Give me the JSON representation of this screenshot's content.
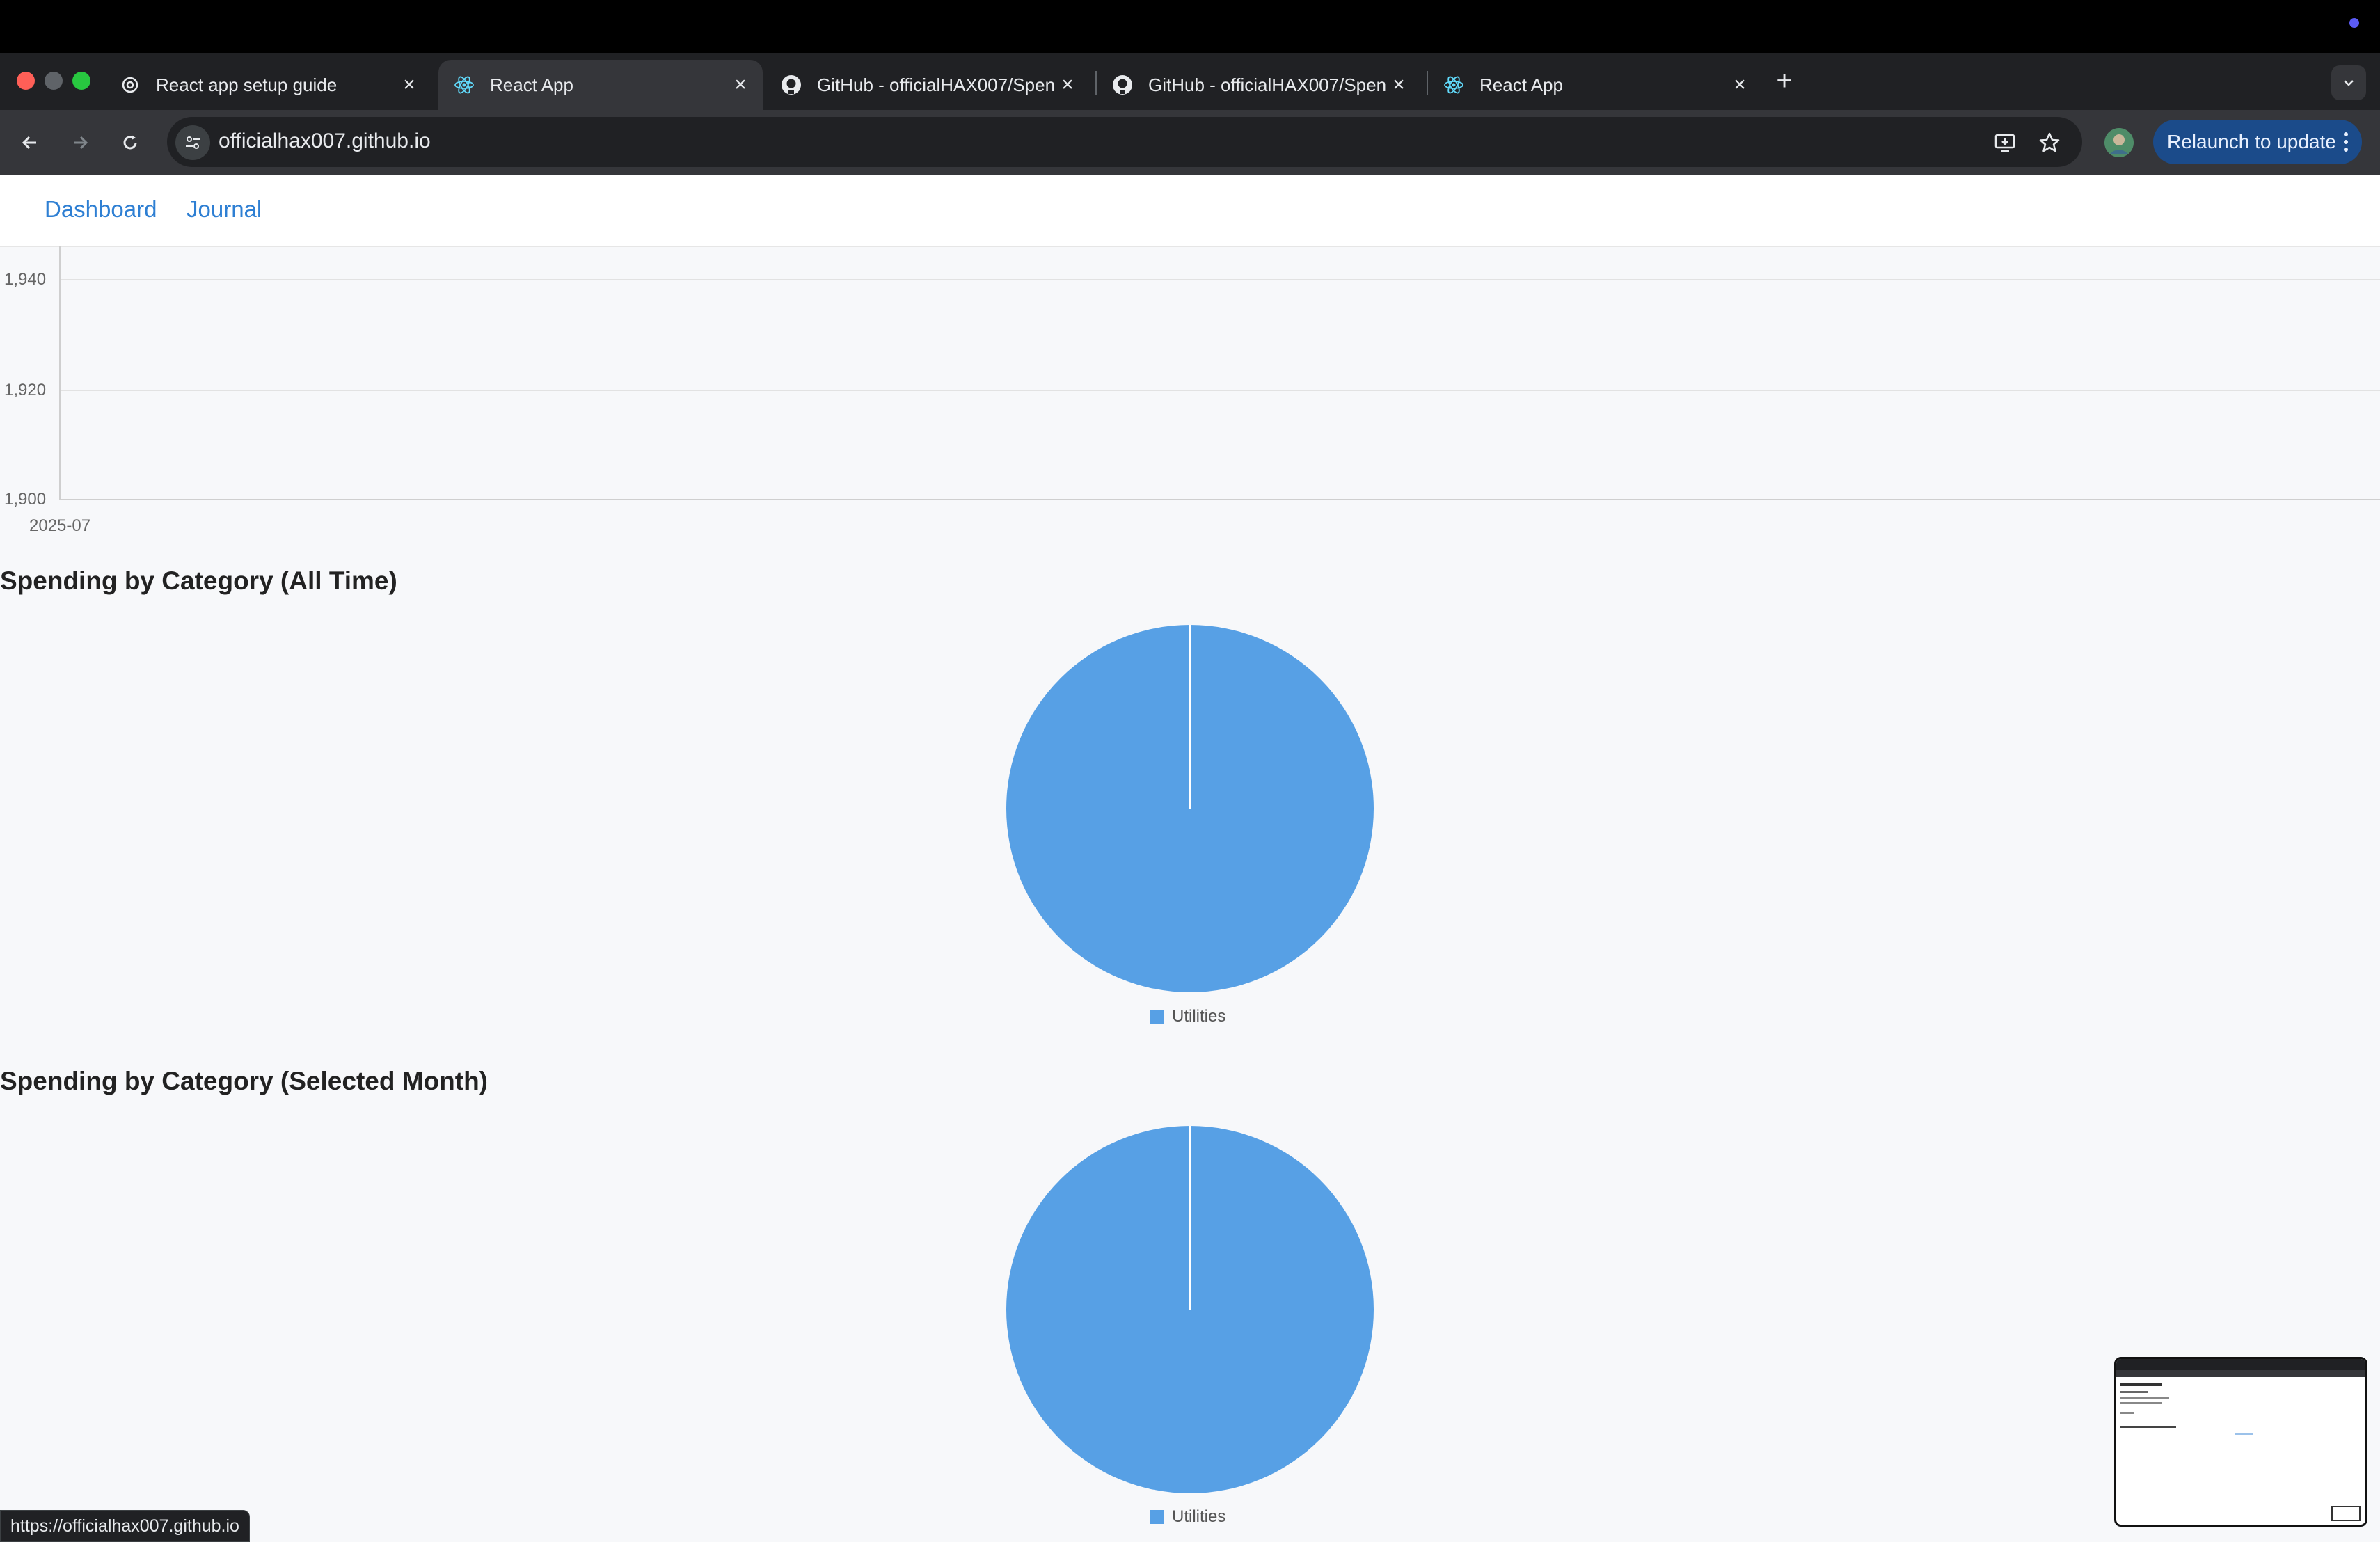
{
  "browser": {
    "tabs": [
      {
        "title": "React app setup guide",
        "icon": "openai-icon",
        "active": false
      },
      {
        "title": "React App",
        "icon": "react-icon",
        "active": true
      },
      {
        "title": "GitHub - officialHAX007/Spen",
        "icon": "github-icon",
        "active": false
      },
      {
        "title": "GitHub - officialHAX007/Spen",
        "icon": "github-icon",
        "active": false
      },
      {
        "title": "React App",
        "icon": "react-icon",
        "active": false
      }
    ],
    "url": "officialhax007.github.io",
    "relaunch_label": "Relaunch to update",
    "status_url": "https://officialhax007.github.io"
  },
  "app": {
    "nav": [
      {
        "label": "Dashboard"
      },
      {
        "label": "Journal"
      }
    ]
  },
  "top_chart": {
    "yticks": [
      "1,940",
      "1,920",
      "1,900"
    ],
    "xtick": "2025-07"
  },
  "sections": [
    {
      "title": "Spending by Category (All Time)",
      "legend": "Utilities"
    },
    {
      "title": "Spending by Category (Selected Month)",
      "legend": "Utilities"
    }
  ],
  "chart_data": [
    {
      "type": "line",
      "x": [
        "2025-07"
      ],
      "ylim": [
        1900,
        1940
      ],
      "yticks": [
        1900,
        1920,
        1940
      ],
      "grid": true
    },
    {
      "type": "pie",
      "title": "Spending by Category (All Time)",
      "categories": [
        "Utilities"
      ],
      "values": [
        100
      ],
      "colors": [
        "#57a0e5"
      ]
    },
    {
      "type": "pie",
      "title": "Spending by Category (Selected Month)",
      "categories": [
        "Utilities"
      ],
      "values": [
        100
      ],
      "colors": [
        "#57a0e5"
      ]
    }
  ],
  "colors": {
    "accent": "#2e7fd3",
    "pie": "#57a0e5"
  }
}
